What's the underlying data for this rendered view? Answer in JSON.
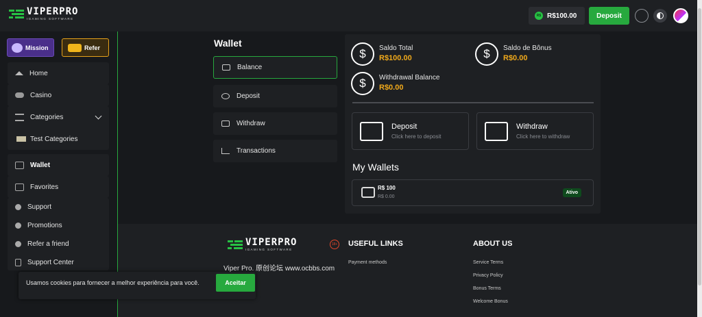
{
  "brand": {
    "name": "VIPERPRO",
    "tagline": "IGAMING SOFTWARE"
  },
  "header": {
    "balance": "R$100.00",
    "currency_badge": "R$",
    "deposit_label": "Deposit"
  },
  "sidebar": {
    "promos": [
      {
        "label": "Mission"
      },
      {
        "label": "Refer"
      }
    ],
    "main": [
      {
        "label": "Home",
        "icon": "home-icon"
      },
      {
        "label": "Casino",
        "icon": "gamepad-icon"
      }
    ],
    "categories": {
      "label": "Categories",
      "sub": "Test Categories"
    },
    "wallet": [
      {
        "label": "Wallet"
      },
      {
        "label": "Favorites"
      }
    ],
    "support": [
      {
        "label": "Support"
      },
      {
        "label": "Promotions"
      },
      {
        "label": "Refer a friend"
      },
      {
        "label": "Support Center"
      }
    ]
  },
  "wallet_menu": {
    "title": "Wallet",
    "items": [
      "Balance",
      "Deposit",
      "Withdraw",
      "Transactions"
    ],
    "active": "Balance"
  },
  "balances": {
    "total_label": "Saldo Total",
    "total_value": "R$100.00",
    "bonus_label": "Saldo de Bônus",
    "bonus_value": "R$0.00",
    "withdrawal_label": "Withdrawal Balance",
    "withdrawal_value": "R$0.00"
  },
  "actions": {
    "deposit_title": "Deposit",
    "deposit_sub": "Click here to deposit",
    "withdraw_title": "Withdraw",
    "withdraw_sub": "Click here to withdraw"
  },
  "my_wallets": {
    "title": "My Wallets",
    "items": [
      {
        "name": "R$ 100",
        "balance": "R$ 0.00",
        "status": "Ativo"
      }
    ]
  },
  "footer": {
    "tagline": "Viper Pro. 原创论坛 www.ocbbs.com",
    "age_badge": "18+",
    "useful_links_title": "USEFUL LINKS",
    "useful_links": [
      "Payment methods"
    ],
    "about_title": "ABOUT US",
    "about_links": [
      "Service Terms",
      "Privacy Policy",
      "Bonus Terms",
      "Welcome Bonus"
    ]
  },
  "cookie": {
    "message": "Usamos cookies para fornecer a melhor experiência para você.",
    "accept_label": "Aceitar"
  },
  "colors": {
    "accent": "#27a93e",
    "gold": "#f0a91b",
    "bg": "#17191c",
    "panel": "#1e2023"
  }
}
